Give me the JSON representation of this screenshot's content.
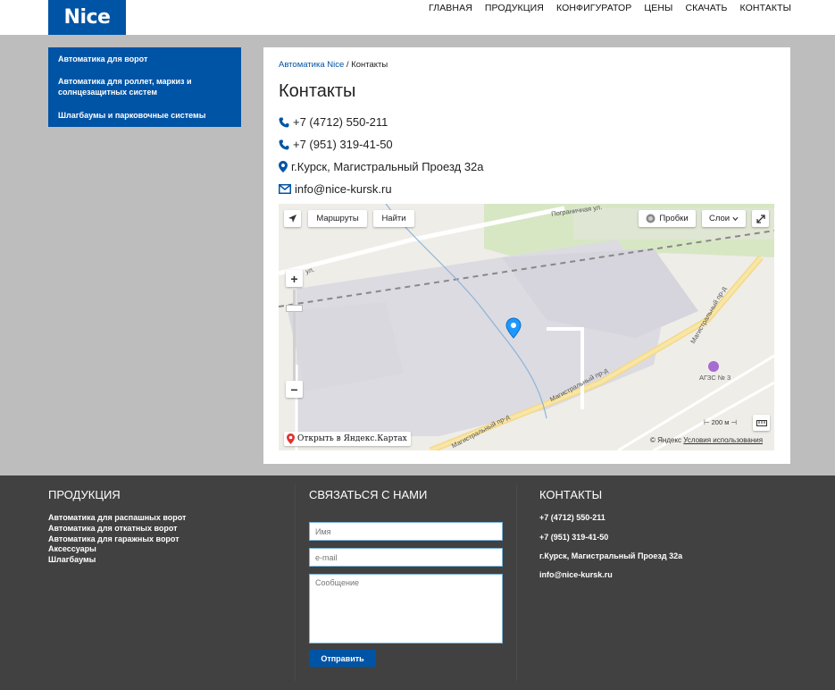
{
  "header": {
    "logo": "Nice",
    "nav": [
      "ГЛАВНАЯ",
      "ПРОДУКЦИЯ",
      "КОНФИГУРАТОР",
      "ЦЕНЫ",
      "СКАЧАТЬ",
      "КОНТАКТЫ"
    ]
  },
  "sidebar": {
    "items": [
      "Автоматика для ворот",
      "Автоматика для роллет, маркиз и солнцезащитных систем",
      "Шлагбаумы и парковочные системы"
    ]
  },
  "content": {
    "breadcrumb_link": "Автоматика Nice",
    "breadcrumb_sep": " / ",
    "breadcrumb_current": "Контакты",
    "title": "Контакты",
    "phone1": "+7 (4712) 550-211",
    "phone2": "+7 (951) 319-41-50",
    "address": "г.Курск, Магистральный Проезд 32а",
    "email": "info@nice-kursk.ru"
  },
  "map": {
    "routes_label": "Маршруты",
    "find_label": "Найти",
    "traffic_label": "Пробки",
    "layers_label": "Слои",
    "open_label": "Открыть в Яндекс.Картах",
    "scale_label": "200 м",
    "copyright": "© Яндекс",
    "terms": "Условия использования",
    "streets": [
      "Пограничная ул.",
      "Магистральный пр-д",
      "Магистральный пр-д",
      "Магистральный пр-д",
      "ул."
    ],
    "poi": "АГЗС № 3"
  },
  "footer": {
    "products_title": "ПРОДУКЦИЯ",
    "products": [
      "Автоматика для распашных ворот",
      "Автоматика для откатных ворот",
      "Автоматика для гаражных ворот",
      "Аксессуары",
      "Шлагбаумы"
    ],
    "contact_form_title": "СВЯЗАТЬСЯ С НАМИ",
    "name_placeholder": "Имя",
    "email_placeholder": "e-mail",
    "message_placeholder": "Сообщение",
    "submit_label": "Отправить",
    "contacts_title": "КОНТАКТЫ",
    "contacts": [
      "+7 (4712) 550-211",
      "+7 (951) 319-41-50",
      "г.Курск, Магистральный Проезд 32а",
      "info@nice-kursk.ru"
    ]
  },
  "colors": {
    "brand_blue": "#0054a5",
    "footer_bg": "#414141",
    "page_bg": "#bdbdbd"
  }
}
